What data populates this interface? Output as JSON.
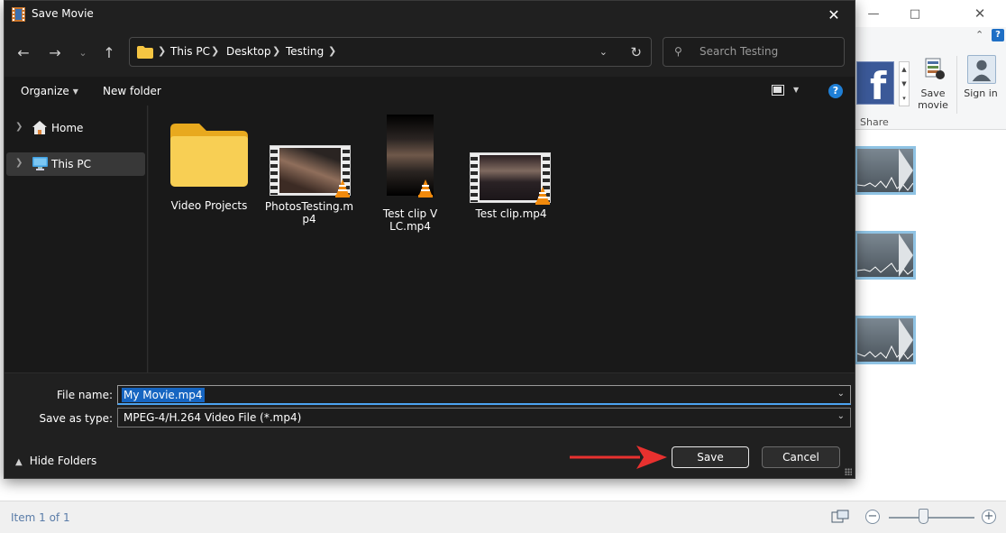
{
  "dialog": {
    "title": "Save Movie",
    "breadcrumb": [
      "This PC",
      "Desktop",
      "Testing"
    ],
    "search_placeholder": "Search Testing",
    "commands": {
      "organize": "Organize",
      "new_folder": "New folder"
    },
    "nav_items": [
      {
        "label": "Home",
        "selected": false
      },
      {
        "label": "This PC",
        "selected": true
      }
    ],
    "files": [
      {
        "name": "Video Projects",
        "kind": "folder"
      },
      {
        "name": "PhotosTesting.mp4",
        "kind": "video"
      },
      {
        "name": "Test clip VLC.mp4",
        "kind": "video-portrait"
      },
      {
        "name": "Test clip.mp4",
        "kind": "video"
      }
    ],
    "file_name_label": "File name:",
    "file_name_value": "My Movie.mp4",
    "save_type_label": "Save as type:",
    "save_type_value": "MPEG-4/H.264 Video File (*.mp4)",
    "hide_folders": "Hide Folders",
    "save_button": "Save",
    "cancel_button": "Cancel"
  },
  "background_app": {
    "ribbon": {
      "save_movie": "Save movie",
      "sign_in": "Sign in",
      "share_group": "Share"
    },
    "status_text": "Item 1 of 1"
  },
  "colors": {
    "accent": "#1665c1",
    "arrow": "#e8312f",
    "dialog_bg": "#202020",
    "folder": "#f5c542"
  }
}
